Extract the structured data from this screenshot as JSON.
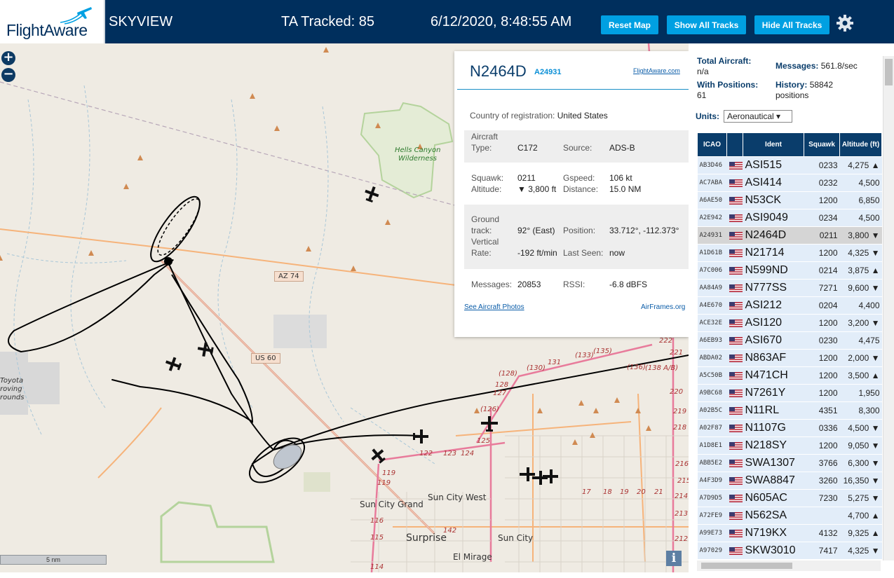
{
  "header": {
    "logo_text": "FlightAware",
    "app_title": "SKYVIEW",
    "ta_tracked": "TA Tracked: 85",
    "datetime": "6/12/2020, 8:48:55 AM",
    "reset_label": "Reset Map",
    "show_label": "Show All Tracks",
    "hide_label": "Hide All Tracks"
  },
  "map": {
    "zoom_in": "+",
    "zoom_out": "−",
    "labels": {
      "hells": "Hells Canyon",
      "wilderness": "Wilderness",
      "az74": "AZ 74",
      "us60": "US 60",
      "toyota": "Toyota",
      "proving": "roving",
      "grounds": "rounds",
      "sun_city_grand": "Sun City Grand",
      "sun_city_west": "Sun City West",
      "surprise": "Surprise",
      "sun_city": "Sun City",
      "el_mirage": "El Mirage"
    },
    "scale": "5 nm",
    "info": "i"
  },
  "detail": {
    "ident": "N2464D",
    "icao": "A24931",
    "fa_link": "FlightAware.com",
    "country_label": "Country of registration:",
    "country": "United States",
    "aircraft_type_label1": "Aircraft",
    "aircraft_type_label2": "Type:",
    "aircraft_type": "C172",
    "source_label": "Source:",
    "source": "ADS-B",
    "squawk_label": "Squawk:",
    "squawk": "0211",
    "gspeed_label": "Gspeed:",
    "gspeed": "106 kt",
    "altitude_label": "Altitude:",
    "altitude": "▼ 3,800 ft",
    "distance_label": "Distance:",
    "distance": "15.0 NM",
    "ground_label1": "Ground",
    "ground_label2": "track:",
    "ground_track": "92° (East)",
    "position_label": "Position:",
    "position": "33.712°, -112.373°",
    "vertical_label1": "Vertical",
    "vertical_label2": "Rate:",
    "vertical_rate": "-192 ft/min",
    "last_seen_label": "Last Seen:",
    "last_seen": "now",
    "messages_label": "Messages:",
    "messages": "20853",
    "rssi_label": "RSSI:",
    "rssi": "-6.8 dBFS",
    "photos_link": "See Aircraft Photos",
    "airframes": "AirFrames.org"
  },
  "side": {
    "total_label": "Total Aircraft:",
    "total": "n/a",
    "messages_label": "Messages:",
    "messages": "561.8/sec",
    "with_pos_label": "With Positions:",
    "with_pos": "61",
    "history_label": "History:",
    "history": "58842",
    "history_unit": "positions",
    "units_label": "Units:",
    "units_value": "Aeronautical ▾",
    "columns": [
      "ICAO",
      "",
      "Ident",
      "Squawk",
      "Altitude (ft)"
    ],
    "rows": [
      {
        "icao": "AB3D46",
        "ident": "ASI515",
        "squawk": "0233",
        "alt": "4,275 ▲"
      },
      {
        "icao": "AC7ABA",
        "ident": "ASI414",
        "squawk": "0232",
        "alt": "4,500"
      },
      {
        "icao": "A6AE50",
        "ident": "N53CK",
        "squawk": "1200",
        "alt": "6,850"
      },
      {
        "icao": "A2E942",
        "ident": "ASI9049",
        "squawk": "0234",
        "alt": "4,500"
      },
      {
        "icao": "A24931",
        "ident": "N2464D",
        "squawk": "0211",
        "alt": "3,800 ▼"
      },
      {
        "icao": "A1D61B",
        "ident": "N21714",
        "squawk": "1200",
        "alt": "4,325 ▼"
      },
      {
        "icao": "A7C006",
        "ident": "N599ND",
        "squawk": "0214",
        "alt": "3,875 ▲"
      },
      {
        "icao": "AA84A9",
        "ident": "N777SS",
        "squawk": "7271",
        "alt": "9,600 ▼"
      },
      {
        "icao": "A4E670",
        "ident": "ASI212",
        "squawk": "0204",
        "alt": "4,400"
      },
      {
        "icao": "ACE32E",
        "ident": "ASI120",
        "squawk": "1200",
        "alt": "3,200 ▼"
      },
      {
        "icao": "A6EB93",
        "ident": "ASI670",
        "squawk": "0230",
        "alt": "4,475"
      },
      {
        "icao": "ABDA02",
        "ident": "N863AF",
        "squawk": "1200",
        "alt": "2,000 ▼"
      },
      {
        "icao": "A5C50B",
        "ident": "N471CH",
        "squawk": "1200",
        "alt": "3,500 ▲"
      },
      {
        "icao": "A9BC68",
        "ident": "N7261Y",
        "squawk": "1200",
        "alt": "1,950"
      },
      {
        "icao": "A02B5C",
        "ident": "N11RL",
        "squawk": "4351",
        "alt": "8,300"
      },
      {
        "icao": "A02F87",
        "ident": "N1107G",
        "squawk": "0336",
        "alt": "4,500 ▼"
      },
      {
        "icao": "A1D8E1",
        "ident": "N218SY",
        "squawk": "1200",
        "alt": "9,050 ▼"
      },
      {
        "icao": "ABB5E2",
        "ident": "SWA1307",
        "squawk": "3766",
        "alt": "6,300 ▼"
      },
      {
        "icao": "A4F3D9",
        "ident": "SWA8847",
        "squawk": "3260",
        "alt": "16,350 ▼"
      },
      {
        "icao": "A7D9D5",
        "ident": "N605AC",
        "squawk": "7230",
        "alt": "5,275 ▼"
      },
      {
        "icao": "A72FE9",
        "ident": "N562SA",
        "squawk": "",
        "alt": "4,700 ▲"
      },
      {
        "icao": "A99E73",
        "ident": "N719KX",
        "squawk": "4132",
        "alt": "9,325 ▲"
      },
      {
        "icao": "A97029",
        "ident": "SKW3010",
        "squawk": "7417",
        "alt": "4,325 ▼"
      }
    ]
  },
  "colors": {
    "header_bg": "#002f5d",
    "button_bg": "#00a0e2",
    "table_header": "#0a3d6b",
    "row_bg": "#e2edf9",
    "selected_row": "#d5d5d5"
  }
}
